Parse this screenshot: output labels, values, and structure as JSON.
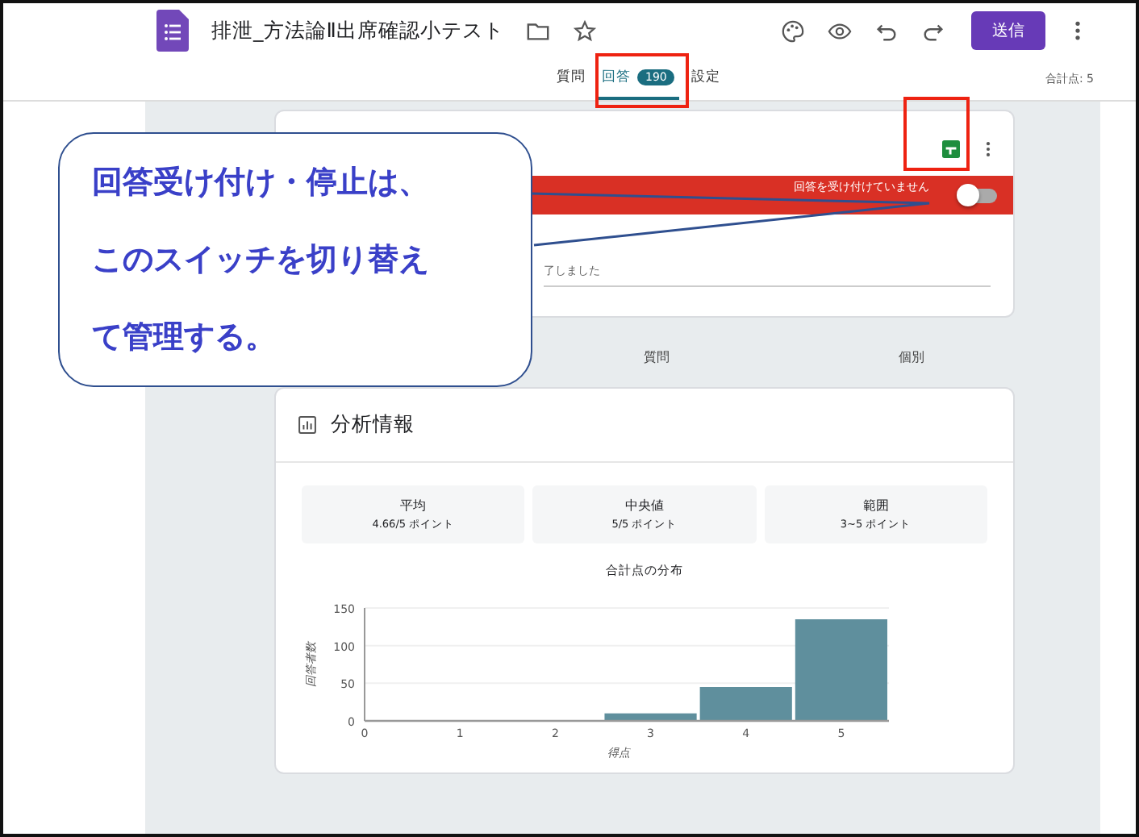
{
  "header": {
    "title": "排泄_方法論Ⅱ出席確認小テスト",
    "send_button": "送信"
  },
  "tabs": [
    {
      "label": "質問",
      "selected": false
    },
    {
      "label": "回答",
      "selected": true,
      "badge": "190"
    },
    {
      "label": "設定",
      "selected": false
    }
  ],
  "total_points": "合計点: 5",
  "responses_card": {
    "accepting": false,
    "banner_text": "回答を受け付けていません",
    "message": "了しました"
  },
  "view_tabs": [
    {
      "label": "質問",
      "selected": false
    },
    {
      "label": "個別",
      "selected": false
    }
  ],
  "insights": {
    "title": "分析情報",
    "stats": [
      {
        "label": "平均",
        "value": "4.66/5 ポイント"
      },
      {
        "label": "中央値",
        "value": "5/5 ポイント"
      },
      {
        "label": "範囲",
        "value": "3~5 ポイント"
      }
    ],
    "chart_data": {
      "type": "bar",
      "title": "合計点の分布",
      "xlabel": "得点",
      "ylabel": "回答者数",
      "x": [
        1,
        2,
        3,
        4,
        5
      ],
      "series": [
        {
          "color": "#5f8f9d",
          "values": [
            0,
            0,
            10,
            45,
            135
          ]
        }
      ],
      "xlim": [
        0,
        5.5
      ],
      "ylim": [
        0,
        150
      ],
      "xticks": [
        0,
        1,
        2,
        3,
        4,
        5
      ],
      "yticks": [
        0,
        50,
        100,
        150
      ]
    }
  },
  "callout": {
    "lines": [
      "回答受け付け・停止は、",
      "このスイッチを切り替え",
      "て管理する。"
    ]
  }
}
